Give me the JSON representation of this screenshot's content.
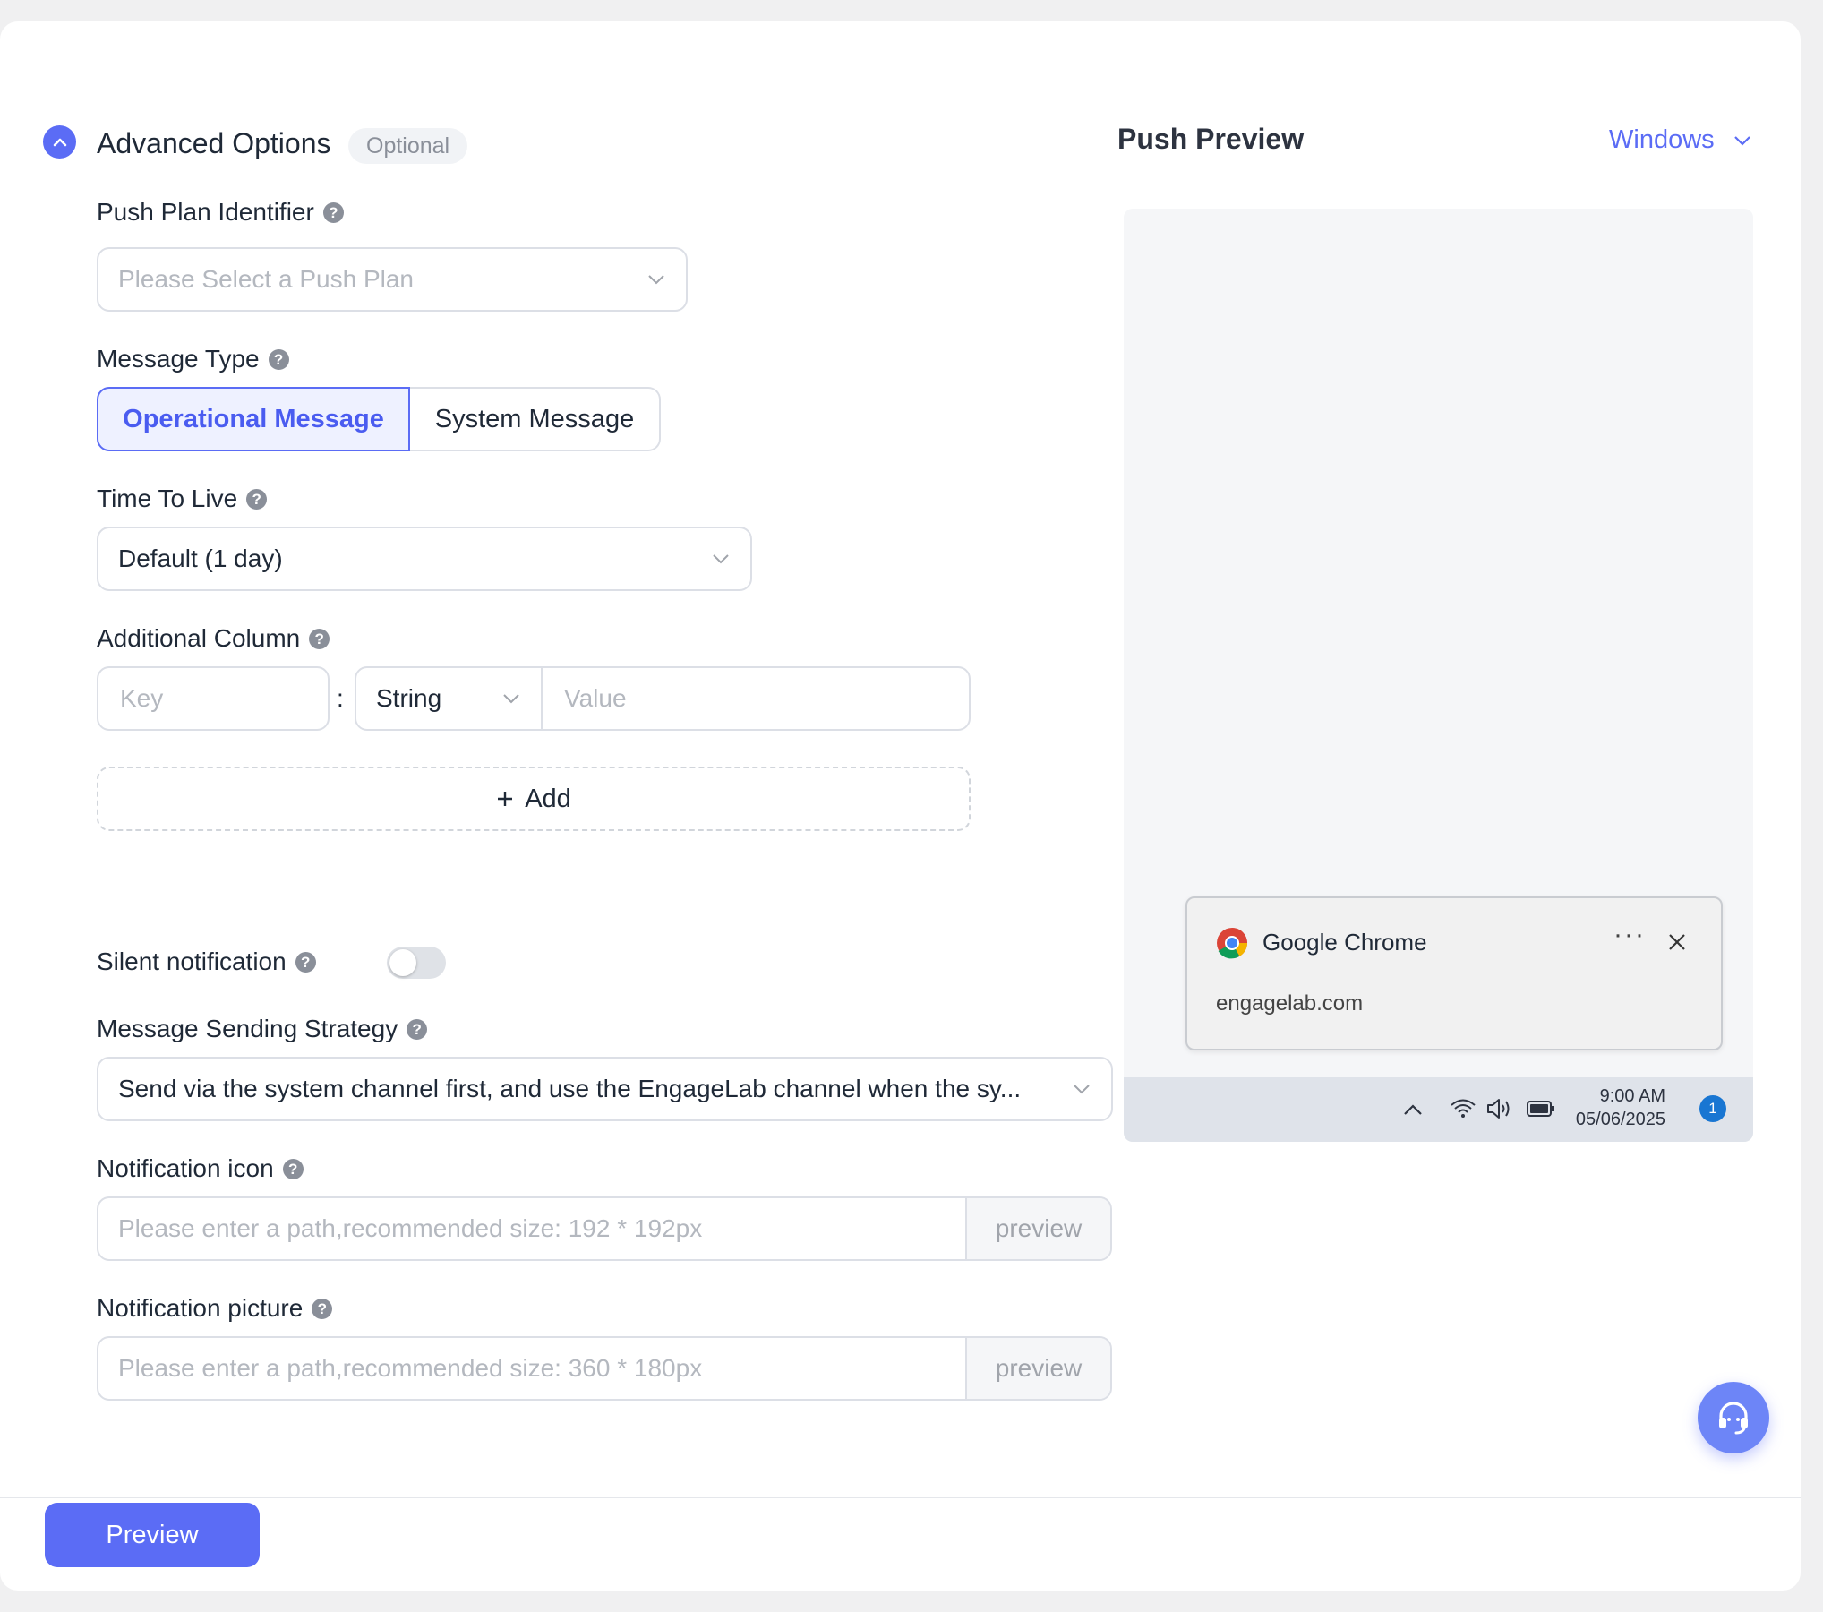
{
  "advanced": {
    "title": "Advanced Options",
    "badge": "Optional"
  },
  "fields": {
    "push_plan": {
      "label": "Push Plan Identifier",
      "placeholder": "Please Select a Push Plan"
    },
    "message_type": {
      "label": "Message Type",
      "options": [
        "Operational Message",
        "System Message"
      ],
      "selected": "Operational Message"
    },
    "ttl": {
      "label": "Time To Live",
      "value": "Default (1 day)"
    },
    "additional_column": {
      "label": "Additional Column",
      "key_placeholder": "Key",
      "separator": ":",
      "type_value": "String",
      "value_placeholder": "Value",
      "add_label": "Add"
    },
    "silent": {
      "label": "Silent notification",
      "enabled": false
    },
    "strategy": {
      "label": "Message Sending Strategy",
      "value": "Send via the system channel first, and use the EngageLab channel when the sy..."
    },
    "icon": {
      "label": "Notification icon",
      "placeholder": "Please enter a path,recommended size: 192 * 192px",
      "addon": "preview"
    },
    "picture": {
      "label": "Notification picture",
      "placeholder": "Please enter a path,recommended size: 360 * 180px",
      "addon": "preview"
    }
  },
  "preview": {
    "title": "Push Preview",
    "os": "Windows",
    "notification": {
      "app": "Google Chrome",
      "more": "···",
      "domain": "engagelab.com"
    },
    "taskbar": {
      "time": "9:00 AM",
      "date": "05/06/2025",
      "badge": "1"
    }
  },
  "footer": {
    "preview_button": "Preview"
  },
  "colors": {
    "accent": "#5b6cf5",
    "active_bg": "#eef1ff",
    "fab": "#6d85f7"
  }
}
